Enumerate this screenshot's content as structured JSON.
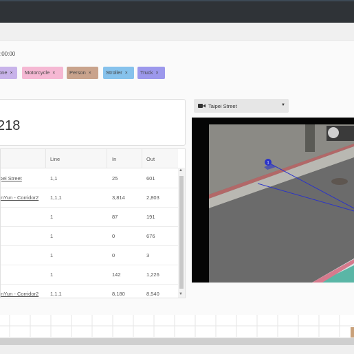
{
  "header": {
    "time_text": ":00:00"
  },
  "tags": [
    {
      "label": "one",
      "color": "#c8b3ea"
    },
    {
      "label": "Motorcycle",
      "color": "#f5b8d3"
    },
    {
      "label": "Person",
      "color": "#c9a38c"
    },
    {
      "label": "Stroller",
      "color": "#86c2ec"
    },
    {
      "label": "Truck",
      "color": "#9c98ec"
    }
  ],
  "tag_close": "×",
  "summary": {
    "total": "218"
  },
  "table": {
    "headers": [
      "",
      "Line",
      "In",
      "Out"
    ],
    "rows": [
      {
        "name": "ipei Street",
        "line": "1,1",
        "in": "25",
        "out": "601"
      },
      {
        "name": "onYun - Corridor2",
        "line": "1,1,1",
        "in": "3,814",
        "out": "2,803"
      },
      {
        "name": "",
        "line": "1",
        "in": "87",
        "out": "191"
      },
      {
        "name": "",
        "line": "1",
        "in": "0",
        "out": "676"
      },
      {
        "name": "",
        "line": "1",
        "in": "0",
        "out": "3"
      },
      {
        "name": "",
        "line": "1",
        "in": "142",
        "out": "1,226"
      },
      {
        "name": "onYun - Corridor2",
        "line": "1,1,1",
        "in": "8,180",
        "out": "8,540"
      }
    ]
  },
  "camera": {
    "selected": "Taipei Street",
    "line_marker": "1"
  },
  "scroll": {
    "up": "▲",
    "down": "▼"
  },
  "caret": "▼"
}
